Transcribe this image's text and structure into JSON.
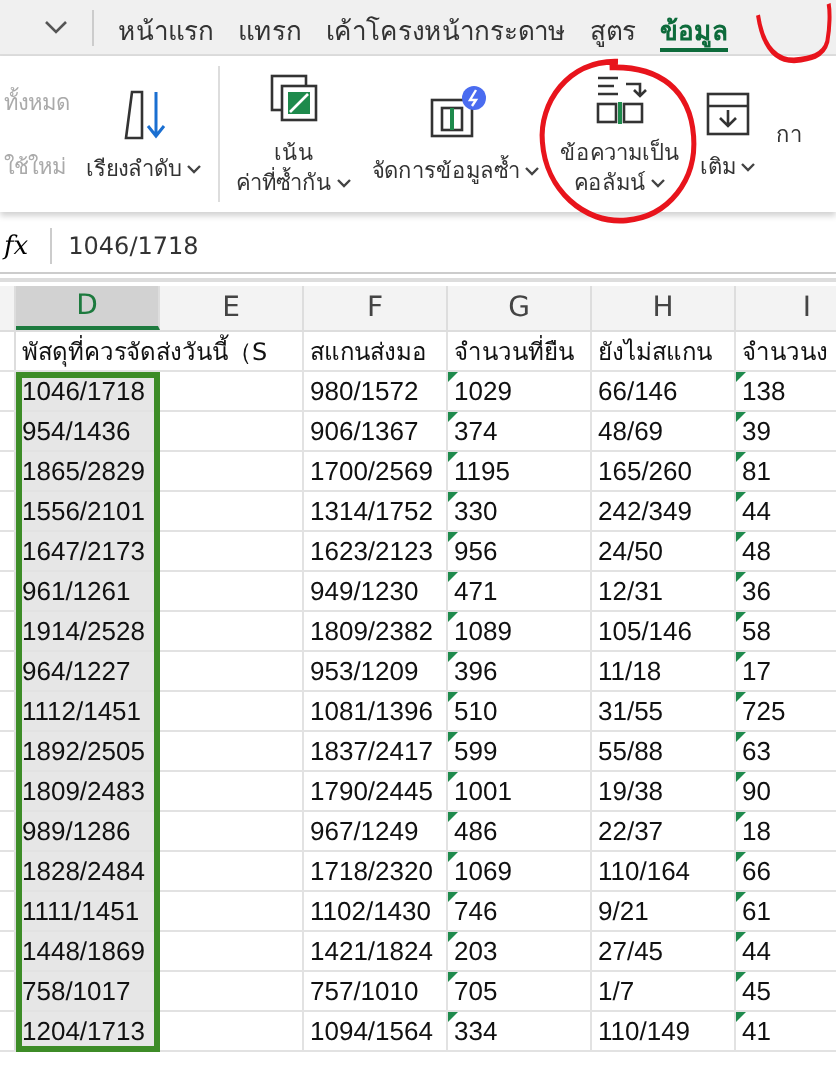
{
  "tabs": [
    {
      "label": "หน้าแรก",
      "selected": false
    },
    {
      "label": "แทรก",
      "selected": false
    },
    {
      "label": "เค้าโครงหน้ากระดาษ",
      "selected": false
    },
    {
      "label": "สูตร",
      "selected": false
    },
    {
      "label": "ข้อมูล",
      "selected": true
    }
  ],
  "ribbon": {
    "stacked": [
      {
        "label": "ทั้งหมด",
        "disabled": true
      },
      {
        "label": "ใช้ใหม่",
        "disabled": true
      }
    ],
    "commands": [
      {
        "kind": "sort",
        "lines": [
          "เรียงลำดับ"
        ]
      },
      {
        "kind": "highlight",
        "lines": [
          "เน้น",
          "ค่าที่ซ้ำกัน"
        ]
      },
      {
        "kind": "duplicates",
        "lines": [
          "จัดการข้อมูลซ้ำ"
        ]
      },
      {
        "kind": "split",
        "lines": [
          "ข้อความเป็น",
          "คอลัมน์"
        ]
      },
      {
        "kind": "fill",
        "lines": [
          "เติม"
        ]
      },
      {
        "kind": "cut",
        "lines": [
          "กา"
        ]
      }
    ]
  },
  "formula_bar": {
    "label": "fx",
    "value": "1046/1718"
  },
  "columns": [
    {
      "letter": "D",
      "header": "พัสดุที่ควรจัดส่งวันนี้（S",
      "selected": true
    },
    {
      "letter": "E",
      "selected": false
    },
    {
      "letter": "F",
      "header": "สแกนส่งมอ",
      "selected": false
    },
    {
      "letter": "G",
      "header": "จำนวนที่ยืน",
      "selected": false,
      "flagged": true
    },
    {
      "letter": "H",
      "header": "ยังไม่สแกน",
      "selected": false
    },
    {
      "letter": "I",
      "header": "จำนวนง",
      "selected": false,
      "flagged": true
    }
  ],
  "rows": [
    [
      "1046/1718",
      null,
      "980/1572",
      "1029",
      "66/146",
      "138"
    ],
    [
      "954/1436",
      null,
      "906/1367",
      "374",
      "48/69",
      "39"
    ],
    [
      "1865/2829",
      null,
      "1700/2569",
      "1195",
      "165/260",
      "81"
    ],
    [
      "1556/2101",
      null,
      "1314/1752",
      "330",
      "242/349",
      "44"
    ],
    [
      "1647/2173",
      null,
      "1623/2123",
      "956",
      "24/50",
      "48"
    ],
    [
      "961/1261",
      null,
      "949/1230",
      "471",
      "12/31",
      "36"
    ],
    [
      "1914/2528",
      null,
      "1809/2382",
      "1089",
      "105/146",
      "58"
    ],
    [
      "964/1227",
      null,
      "953/1209",
      "396",
      "11/18",
      "17"
    ],
    [
      "1112/1451",
      null,
      "1081/1396",
      "510",
      "31/55",
      "725"
    ],
    [
      "1892/2505",
      null,
      "1837/2417",
      "599",
      "55/88",
      "63"
    ],
    [
      "1809/2483",
      null,
      "1790/2445",
      "1001",
      "19/38",
      "90"
    ],
    [
      "989/1286",
      null,
      "967/1249",
      "486",
      "22/37",
      "18"
    ],
    [
      "1828/2484",
      null,
      "1718/2320",
      "1069",
      "110/164",
      "66"
    ],
    [
      "1111/1451",
      null,
      "1102/1430",
      "746",
      "9/21",
      "61"
    ],
    [
      "1448/1869",
      null,
      "1421/1824",
      "203",
      "27/45",
      "44"
    ],
    [
      "758/1017",
      null,
      "757/1010",
      "705",
      "1/7",
      "45"
    ],
    [
      "1204/1713",
      null,
      "1094/1564",
      "334",
      "110/149",
      "41"
    ]
  ]
}
